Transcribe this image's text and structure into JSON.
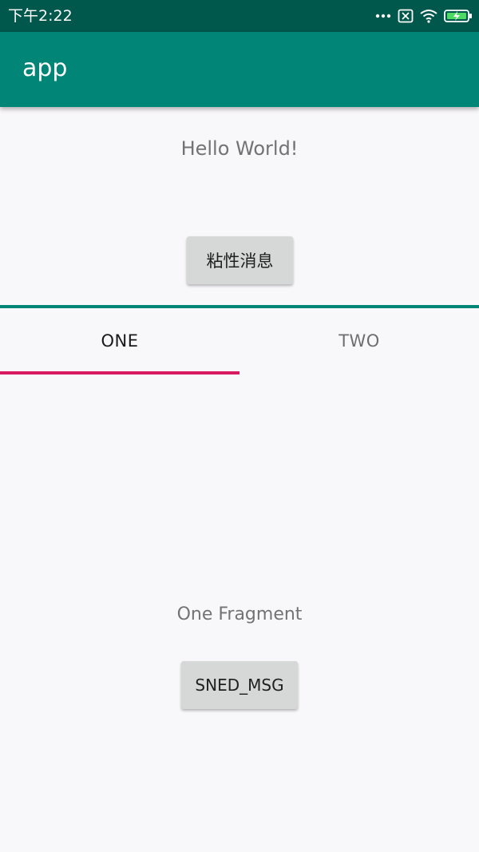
{
  "status_bar": {
    "time": "下午2:22",
    "icons": [
      "more-dots-icon",
      "sim-off-icon",
      "wifi-icon",
      "battery-charging-icon"
    ]
  },
  "app_bar": {
    "title": "app"
  },
  "main": {
    "hello_text": "Hello World!",
    "sticky_button_label": "粘性消息"
  },
  "tabs": {
    "items": [
      {
        "label": "ONE",
        "selected": true
      },
      {
        "label": "TWO",
        "selected": false
      }
    ]
  },
  "fragment": {
    "label": "One Fragment",
    "send_button_label": "SNED_MSG"
  },
  "colors": {
    "status_bar": "#00574b",
    "primary": "#008577",
    "accent": "#d81b60",
    "background": "#f8f7f9",
    "button": "#d6d7d7"
  }
}
